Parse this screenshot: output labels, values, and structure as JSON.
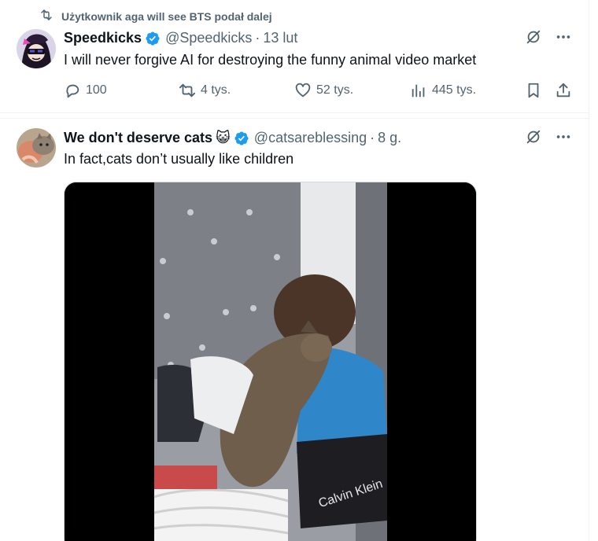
{
  "repost": {
    "icon": "repost-icon",
    "text": "Użytkownik aga will see BTS podał dalej"
  },
  "tweet1": {
    "author_name": "Speedkicks",
    "handle": "@Speedkicks",
    "separator": "·",
    "time": "13 lut",
    "text": "I will never forgive AI for destroying the funny animal video market",
    "actions": {
      "reply_count": "100",
      "repost_count": "4 tys.",
      "like_count": "52 tys.",
      "view_count": "445 tys."
    }
  },
  "tweet2": {
    "author_name": "We don't deserve cats",
    "emoji": "😺",
    "handle": "@catsareblessing",
    "separator": "·",
    "time": "8 g.",
    "text": "In fact,cats don’t usually like children",
    "video_text": "Calvin Klein"
  },
  "colors": {
    "text_primary": "#0f1419",
    "text_secondary": "#536471",
    "verified_blue": "#1d9bf0",
    "divider": "#eff3f4"
  }
}
